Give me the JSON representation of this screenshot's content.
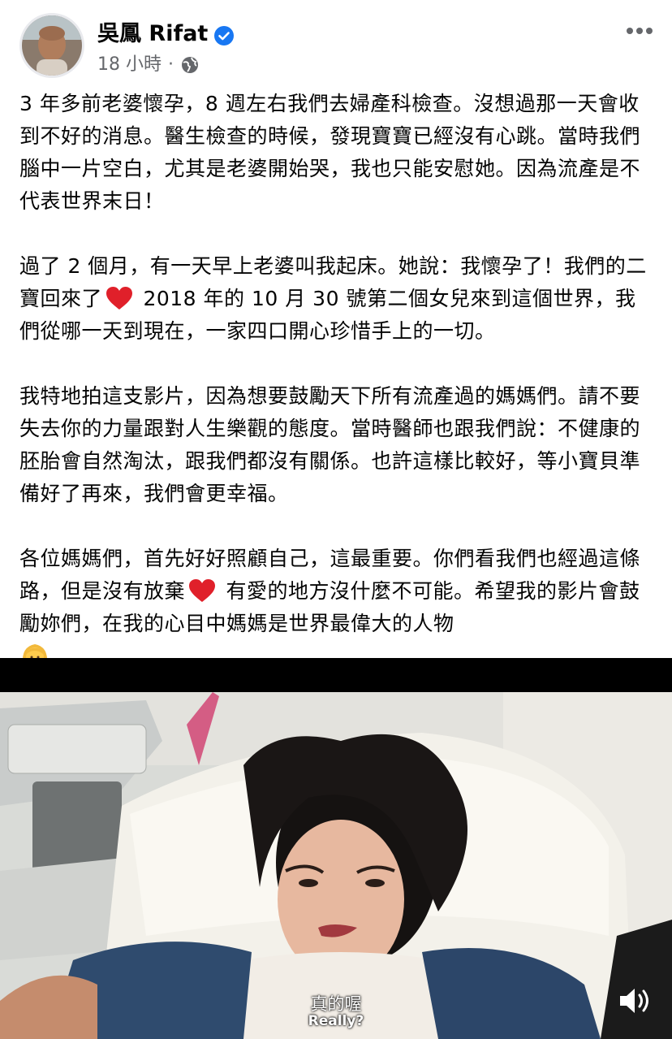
{
  "post": {
    "author": "吳鳳 Rifat",
    "time": "18 小時",
    "separator": "·",
    "paragraphs": [
      "3 年多前老婆懷孕，8 週左右我們去婦產科檢查。沒想過那一天會收到不好的消息。醫生檢查的時候，發現寶寶已經沒有心跳。當時我們腦中一片空白，尤其是老婆開始哭，我也只能安慰她。因為流產是不代表世界末日！",
      "我特地拍這支影片，因為想要鼓勵天下所有流產過的媽媽們。請不要失去你的力量跟對人生樂觀的態度。當時醫師也跟我們說：不健康的胚胎會自然淘汰，跟我們都沒有關係。也許這樣比較好，等小寶貝準備好了再來，我們會更幸福。"
    ],
    "p2_a": "過了 2 個月，有一天早上老婆叫我起床。她說：我懷孕了！我們的二寶回來了",
    "p2_b": " 2018 年的 10 月 30 號第二個女兒來到這個世界，我們從哪一天到現在，一家四口開心珍惜手上的一切。",
    "p4_a": "各位媽媽們，首先好好照顧自己，這最重要。你們看我們也經過這條路，但是沒有放棄",
    "p4_b": " 有愛的地方沒什麼不可能。希望我的影片會鼓勵妳們，在我的心目中媽媽是世界最偉大的人物"
  },
  "video": {
    "subtitle_cn": "真的喔",
    "subtitle_en": "Really?"
  },
  "icons": {
    "verified": "verified-badge-icon",
    "globe": "globe-icon",
    "more": "more-options-icon",
    "heart": "red-heart-emoji",
    "face": "woman-blond-emoji",
    "sound": "speaker-icon"
  },
  "colors": {
    "verified_blue": "#1877f2",
    "meta_gray": "#65676b",
    "heart_red": "#e0202a"
  }
}
